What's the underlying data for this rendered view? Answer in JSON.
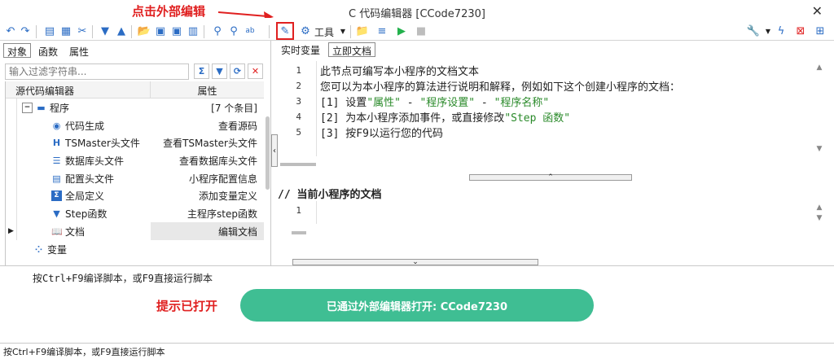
{
  "window": {
    "title": "C 代码编辑器 [CCode7230]",
    "annotation_top": "点击外部编辑",
    "close_glyph": "✕"
  },
  "toolbar": {
    "tools_label": "工具",
    "icons": [
      "undo-icon",
      "redo-icon",
      "copy-icon",
      "paste-icon",
      "cut-icon",
      "move-down-icon",
      "move-up-icon",
      "open-folder-icon",
      "save-icon",
      "save-as-icon",
      "search-icon",
      "replace-icon",
      "abc-icon",
      "external-edit-pencil-icon",
      "gear-icon",
      "open-icon",
      "clear-icon",
      "run-icon",
      "stop-icon",
      "wrench-icon",
      "flash-icon",
      "delete-icon",
      "settings-icon"
    ],
    "accent_red": "#e02020"
  },
  "left_panel": {
    "tabs": [
      "对象",
      "函数",
      "属性"
    ],
    "active_tab": 0,
    "filter_placeholder": "输入过滤字符串...",
    "columns": [
      "源代码编辑器",
      "属性"
    ],
    "rows": [
      {
        "name": "程序",
        "value": "[7 个条目]",
        "icon": "program-icon",
        "level": 0
      },
      {
        "name": "代码生成",
        "value": "查看源码",
        "icon": "code-gen-icon",
        "level": 1
      },
      {
        "name": "TSMaster头文件",
        "value": "查看TSMaster头文件",
        "icon": "header-h-icon",
        "level": 1
      },
      {
        "name": "数据库头文件",
        "value": "查看数据库头文件",
        "icon": "database-icon",
        "level": 1
      },
      {
        "name": "配置头文件",
        "value": "小程序配置信息",
        "icon": "config-icon",
        "level": 1
      },
      {
        "name": "全局定义",
        "value": "添加变量定义",
        "icon": "global-def-icon",
        "level": 1
      },
      {
        "name": "Step函数",
        "value": "主程序step函数",
        "icon": "step-icon",
        "level": 1
      },
      {
        "name": "文档",
        "value": "编辑文档",
        "icon": "document-icon",
        "level": 1
      },
      {
        "name": "变量",
        "value": "",
        "icon": "variable-icon",
        "level": 0
      }
    ]
  },
  "right_panel": {
    "tabs": [
      "实时变量",
      "立即文档"
    ],
    "active_tab": 1,
    "editor_lines": [
      {
        "num": "1",
        "parts": [
          {
            "t": "此节点可编写本小程序的文档文本",
            "s": false
          }
        ]
      },
      {
        "num": "2",
        "parts": [
          {
            "t": "您可以为本小程序的算法进行说明和解释，例如如下这个创建小程序的文档：",
            "s": false
          }
        ]
      },
      {
        "num": "3",
        "parts": [
          {
            "t": "[1] 设置",
            "s": false
          },
          {
            "t": "\"属性\"",
            "s": true
          },
          {
            "t": " - ",
            "s": false
          },
          {
            "t": "\"程序设置\"",
            "s": true
          },
          {
            "t": " - ",
            "s": false
          },
          {
            "t": "\"程序名称\"",
            "s": true
          }
        ]
      },
      {
        "num": "4",
        "parts": [
          {
            "t": "[2] 为本小程序添加事件，或直接修改",
            "s": false
          },
          {
            "t": "\"Step 函数\"",
            "s": true
          }
        ]
      },
      {
        "num": "5",
        "parts": [
          {
            "t": "[3] 按F9以运行您的代码",
            "s": false
          }
        ]
      }
    ],
    "section_title": "// 当前小程序的文档",
    "editor2_line": "1"
  },
  "bottom": {
    "hint": "按Ctrl+F9编译脚本，或F9直接运行脚本",
    "annotation": "提示已打开",
    "toast": "已通过外部编辑器打开: CCode7230",
    "toast_color": "#3fbe93"
  },
  "status": {
    "text": "按Ctrl+F9编译脚本，或F9直接运行脚本"
  }
}
